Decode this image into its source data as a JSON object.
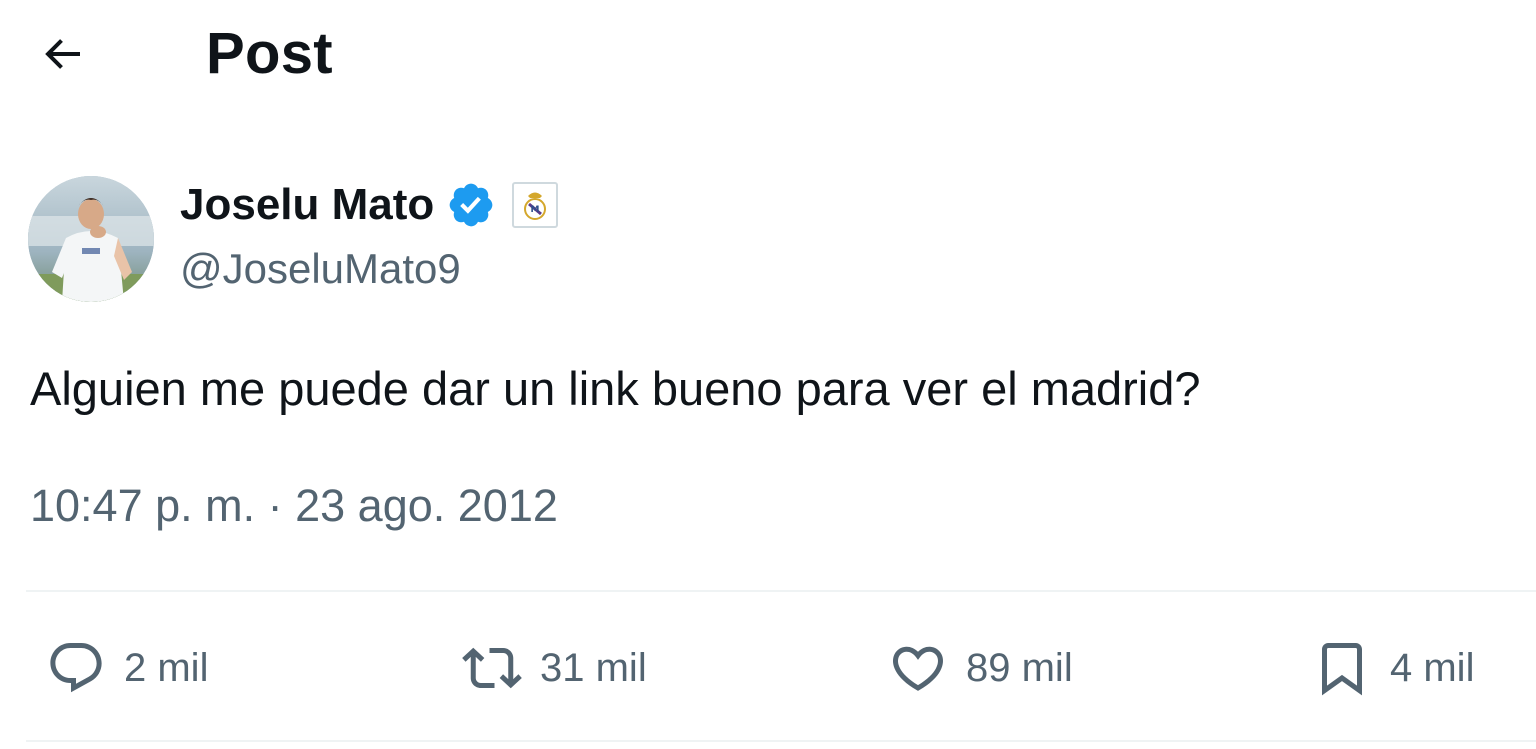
{
  "header": {
    "back_icon": "arrow-left-icon",
    "title": "Post"
  },
  "author": {
    "display_name": "Joselu Mato",
    "handle": "@JoseluMato9",
    "verified_icon": "verified-badge-icon",
    "verified_color": "#1d9bf0",
    "affiliation_icon": "real-madrid-crest-icon"
  },
  "post": {
    "text": "Alguien me puede dar un link bueno para ver el madrid?",
    "timestamp": "10:47 p. m. · 23 ago. 2012"
  },
  "actions": {
    "reply": {
      "icon": "reply-icon",
      "count": "2 mil"
    },
    "repost": {
      "icon": "repost-icon",
      "count": "31 mil"
    },
    "like": {
      "icon": "heart-icon",
      "count": "89 mil"
    },
    "bookmark": {
      "icon": "bookmark-icon",
      "count": "4 mil"
    }
  },
  "colors": {
    "text_primary": "#0f1419",
    "text_secondary": "#536471",
    "divider": "#eff3f4",
    "background": "#ffffff"
  }
}
